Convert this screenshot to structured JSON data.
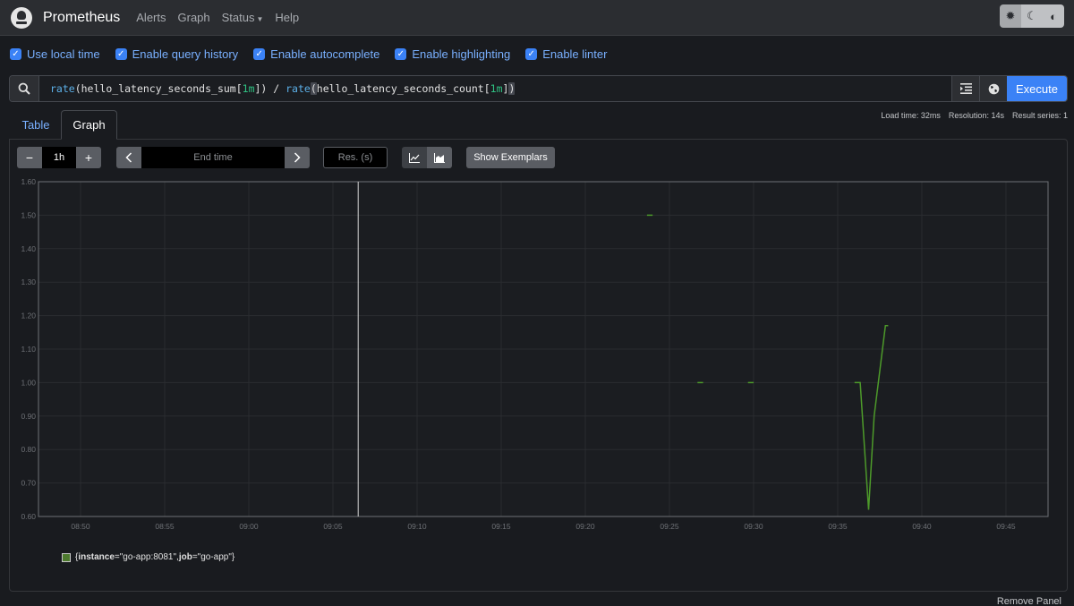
{
  "navbar": {
    "brand": "Prometheus",
    "links": [
      {
        "label": "Alerts"
      },
      {
        "label": "Graph"
      },
      {
        "label": "Status"
      },
      {
        "label": "Help"
      }
    ],
    "theme_buttons": [
      "sun-icon",
      "moon-icon",
      "half-circle-icon"
    ]
  },
  "options": [
    {
      "label": "Use local time",
      "checked": true
    },
    {
      "label": "Enable query history",
      "checked": true
    },
    {
      "label": "Enable autocomplete",
      "checked": true
    },
    {
      "label": "Enable highlighting",
      "checked": true
    },
    {
      "label": "Enable linter",
      "checked": true
    }
  ],
  "query": {
    "fn1": "rate",
    "part1": "(hello_latency_seconds_sum[",
    "num1": "1m",
    "part2": "]) / ",
    "fn2": "rate",
    "open_paren": "(",
    "part3": "hello_latency_seconds_count[",
    "num2": "1m",
    "part4": "]",
    "close_paren": ")"
  },
  "execute_label": "Execute",
  "stats": {
    "load_time": "Load time: 32ms",
    "resolution": "Resolution: 14s",
    "result_series": "Result series: 1"
  },
  "tabs": {
    "table": "Table",
    "graph": "Graph"
  },
  "controls": {
    "range": "1h",
    "end_time_placeholder": "End time",
    "res_placeholder": "Res. (s)",
    "show_exemplars": "Show Exemplars"
  },
  "legend": {
    "prefix": "{",
    "k1": "instance",
    "v1": "=\"go-app:8081\", ",
    "k2": "job",
    "v2": "=\"go-app\"}"
  },
  "remove_panel": "Remove Panel",
  "colors": {
    "accent": "#3b82f6",
    "link": "#79b0ff",
    "series": "#4d9a2a"
  },
  "chart_data": {
    "type": "line",
    "ylim": [
      0.6,
      1.6
    ],
    "y_ticks": [
      "0.60",
      "0.70",
      "0.80",
      "0.90",
      "1.00",
      "1.10",
      "1.20",
      "1.30",
      "1.40",
      "1.50",
      "1.60"
    ],
    "x_range": [
      "08:47:30",
      "09:47:30"
    ],
    "x_ticks": [
      "08:50",
      "08:55",
      "09:00",
      "09:05",
      "09:10",
      "09:15",
      "09:20",
      "09:25",
      "09:30",
      "09:35",
      "09:40",
      "09:45"
    ],
    "cursor_time": "09:06:30",
    "series": [
      {
        "color": "#4d9a2a",
        "segments": [
          [
            [
              "09:23:40",
              1.5
            ],
            [
              "09:24:00",
              1.5
            ]
          ],
          [
            [
              "09:26:40",
              1.0
            ],
            [
              "09:27:00",
              1.0
            ]
          ],
          [
            [
              "09:29:40",
              1.0
            ],
            [
              "09:30:00",
              1.0
            ]
          ],
          [
            [
              "09:36:00",
              1.0
            ],
            [
              "09:36:20",
              1.0
            ],
            [
              "09:36:50",
              0.62
            ],
            [
              "09:37:10",
              0.9
            ],
            [
              "09:37:50",
              1.17
            ],
            [
              "09:38:00",
              1.17
            ]
          ]
        ]
      }
    ]
  }
}
